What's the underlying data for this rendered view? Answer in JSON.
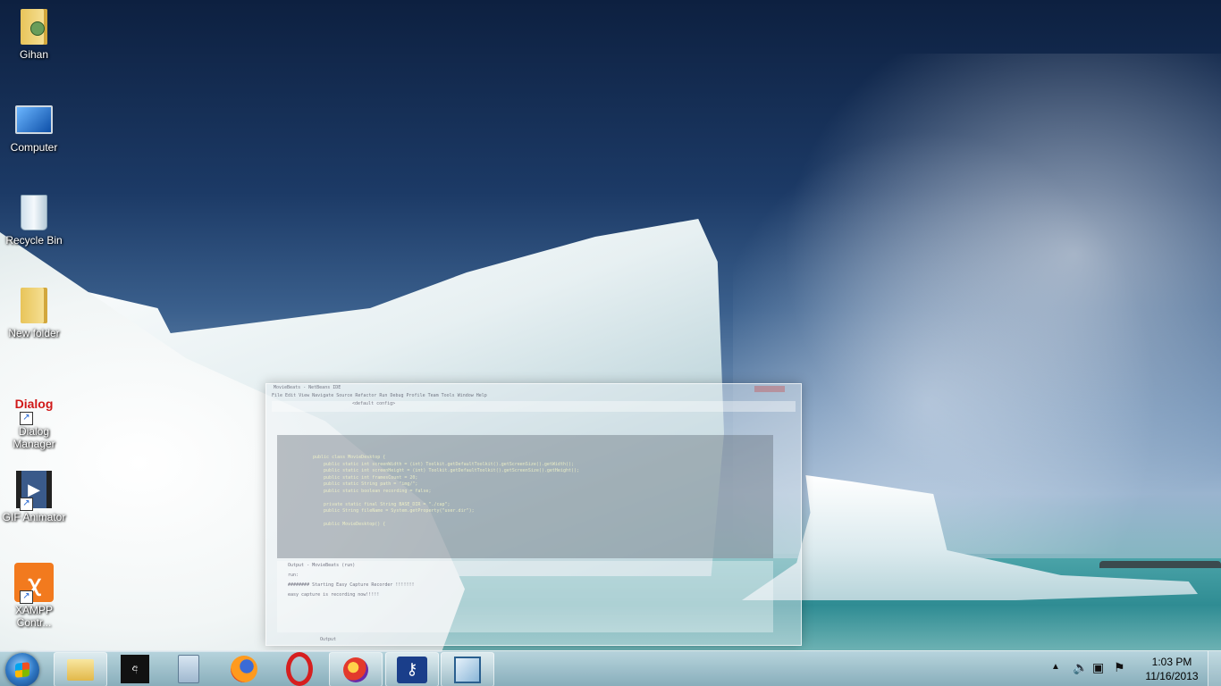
{
  "desktop": {
    "icons": [
      {
        "label": "Gihan",
        "icon": "user-folder-icon"
      },
      {
        "label": "Computer",
        "icon": "computer-icon"
      },
      {
        "label": "Recycle Bin",
        "icon": "recycle-bin-icon"
      },
      {
        "label": "New folder",
        "icon": "folder-icon"
      },
      {
        "label": "Dialog Manager",
        "logo_text": "Dialog",
        "icon": "dialog-manager-icon"
      },
      {
        "label": "GIF Animator",
        "icon": "gif-animator-icon"
      },
      {
        "label": "XAMPP Contr...",
        "icon": "xampp-icon"
      }
    ]
  },
  "ide_window": {
    "title": "MovieBeats - NetBeans IDE",
    "menu": "File  Edit  View  Navigate  Source  Refactor  Run  Debug  Profile  Team  Tools  Window  Help",
    "config": "<default config>",
    "code_lines": [
      "public class MovieDesktop {",
      "    public static int screenWidth = (int) Toolkit.getDefaultToolkit().getScreenSize().getWidth();",
      "    public static int screenHeight = (int) Toolkit.getDefaultToolkit().getScreenSize().getHeight();",
      "    public static int framesCount = 20;",
      "    public static String path = \"img/\";",
      "    public static boolean recording = false;",
      "",
      "    private static final String BASE_DIR = \"./cap\";",
      "    public String fileName = System.getProperty(\"user.dir\");",
      "",
      "    public MovieDesktop() {"
    ],
    "output_title": "Output - MovieBeats (run)",
    "output_lines": [
      "run:",
      "######## Starting Easy Capture Recorder !!!!!!!",
      "easy capture is recording now!!!!!"
    ],
    "status_tab": "Output"
  },
  "taskbar": {
    "items": [
      {
        "name": "windows-explorer",
        "icon": "folder-icon",
        "pinned": true
      },
      {
        "name": "iskoola-madhura",
        "icon": "font-app-icon"
      },
      {
        "name": "calculator",
        "icon": "calculator-icon"
      },
      {
        "name": "firefox",
        "icon": "firefox-icon"
      },
      {
        "name": "opera",
        "icon": "opera-icon"
      },
      {
        "name": "firefox-aurora",
        "icon": "browser-icon",
        "pinned": true
      },
      {
        "name": "keypass",
        "icon": "key-icon",
        "pinned": true
      },
      {
        "name": "virtualbox",
        "icon": "cube-icon",
        "pinned": true
      }
    ],
    "clock_time": "1:03 PM",
    "clock_date": "11/16/2013"
  },
  "colors": {
    "taskbar": "#c8d8e2",
    "xampp": "#f27a1e",
    "opera": "#d61f1f"
  }
}
